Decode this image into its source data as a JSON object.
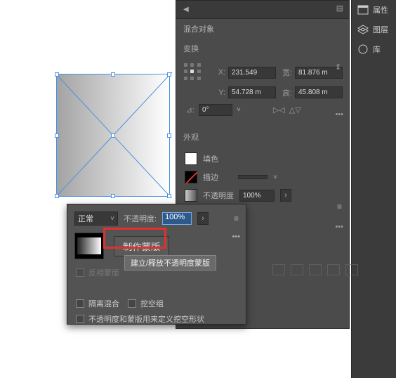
{
  "rightBar": {
    "items": [
      {
        "label": "属性"
      },
      {
        "label": "图层"
      },
      {
        "label": "库"
      }
    ]
  },
  "props": {
    "blendObject": "混合对象",
    "transformTitle": "变换",
    "x": {
      "label": "X:",
      "value": "231.549"
    },
    "y": {
      "label": "Y:",
      "value": "54.728 m"
    },
    "w": {
      "label": "宽:",
      "value": "81.876 m"
    },
    "h": {
      "label": "高:",
      "value": "45.808 m"
    },
    "angle": {
      "label": "⊿:",
      "value": "0°"
    },
    "appearanceTitle": "外观",
    "fillLabel": "填色",
    "strokeLabel": "描边",
    "opacityLabel": "不透明度",
    "opacityValue": "100%",
    "more": "•••"
  },
  "trans": {
    "blendMode": "正常",
    "opacityLabel": "不透明度:",
    "opacityValue": "100%",
    "makeMask": "制作蒙版",
    "tooltip": "建立/释放不透明度蒙版",
    "clipDisabled": "反相蒙版",
    "isolate": "隔离混合",
    "knockout": "挖空组",
    "defineShape": "不透明度和蒙版用来定义挖空形状",
    "panelMore": "•••"
  }
}
